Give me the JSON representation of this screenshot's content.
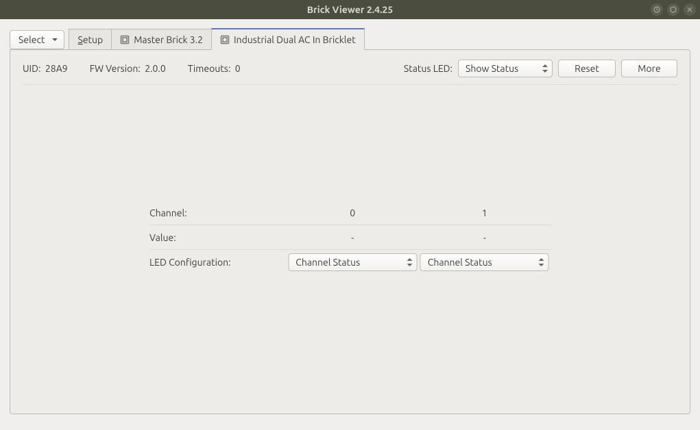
{
  "title": "Brick Viewer 2.4.25",
  "toolbar": {
    "select_label": "Select"
  },
  "tabs": [
    {
      "label": "Setup"
    },
    {
      "label": "Master Brick 3.2"
    },
    {
      "label": "Industrial Dual AC In Bricklet"
    }
  ],
  "status": {
    "uid_label": "UID:",
    "uid_value": "28A9",
    "fw_label": "FW Version:",
    "fw_value": "2.0.0",
    "timeouts_label": "Timeouts:",
    "timeouts_value": "0",
    "statusled_label": "Status LED:",
    "statusled_value": "Show Status",
    "reset_label": "Reset",
    "more_label": "More"
  },
  "table": {
    "channel_label": "Channel:",
    "channels": [
      "0",
      "1"
    ],
    "value_label": "Value:",
    "values": [
      "-",
      "-"
    ],
    "ledcfg_label": "LED Configuration:",
    "ledcfg_values": [
      "Channel Status",
      "Channel Status"
    ]
  }
}
